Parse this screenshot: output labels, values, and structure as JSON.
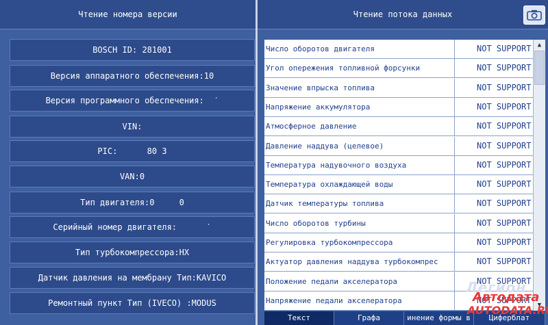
{
  "left_header": {
    "title": "Чтение номера версии"
  },
  "right_header": {
    "title": "Чтение потока данных"
  },
  "info_buttons": [
    "BOSCH ID: 281001",
    "Версия аппаратного обеспечения:10",
    "Версия программного обеспечения:  ˊ",
    "VIN:",
    "PIC:      80 3",
    "VAN:0",
    "Тип двигателя:0     0",
    "Серийный номер двигателя:      ˋ",
    "Тип турбокомпрессора:HX",
    "Датчик давления на мембрану Тип:KAVICO",
    "Ремонтный пункт Тип (IVECO) :MODUS"
  ],
  "data_stream": [
    {
      "name": "Число оборотов двигателя",
      "value": "NOT SUPPORT"
    },
    {
      "name": "Угол опережения топливной форсунки",
      "value": "NOT SUPPORT"
    },
    {
      "name": "Значение впрыска топлива",
      "value": "NOT SUPPORT"
    },
    {
      "name": "Напряжение аккумулятора",
      "value": "NOT SUPPORT"
    },
    {
      "name": "Атмосферное давление",
      "value": "NOT SUPPORT"
    },
    {
      "name": "Давление наддува (целевое)",
      "value": "NOT SUPPORT"
    },
    {
      "name": "Температура надувочного воздуха",
      "value": "NOT SUPPORT"
    },
    {
      "name": "Температура охлаждающей воды",
      "value": "NOT SUPPORT"
    },
    {
      "name": "Датчик температуры топлива",
      "value": "NOT SUPPORT"
    },
    {
      "name": "Число оборотов турбины",
      "value": "NOT SUPPORT"
    },
    {
      "name": "Регулировка турбокомпрессора",
      "value": "NOT SUPPORT"
    },
    {
      "name": "Актуатор давления наддува турбокомпрес",
      "value": "NOT SUPPORT"
    },
    {
      "name": "Положение педали акселератора",
      "value": "NOT SUPPORT"
    },
    {
      "name": "Напряжение педали акселератора",
      "value": "NOT SUPPORT"
    }
  ],
  "tabs": [
    "Текст",
    "Графа",
    "инение формы в",
    "Циферблат"
  ],
  "active_tab": 0,
  "watermark": {
    "line1": "Легион",
    "line2": "Автодата",
    "line3": "AUTODATA.RU"
  },
  "icons": {
    "camera": "camera-icon"
  },
  "colors": {
    "panel": "#3e5fa0",
    "header": "#2f4c8c",
    "table_text": "#1f3d8a"
  }
}
